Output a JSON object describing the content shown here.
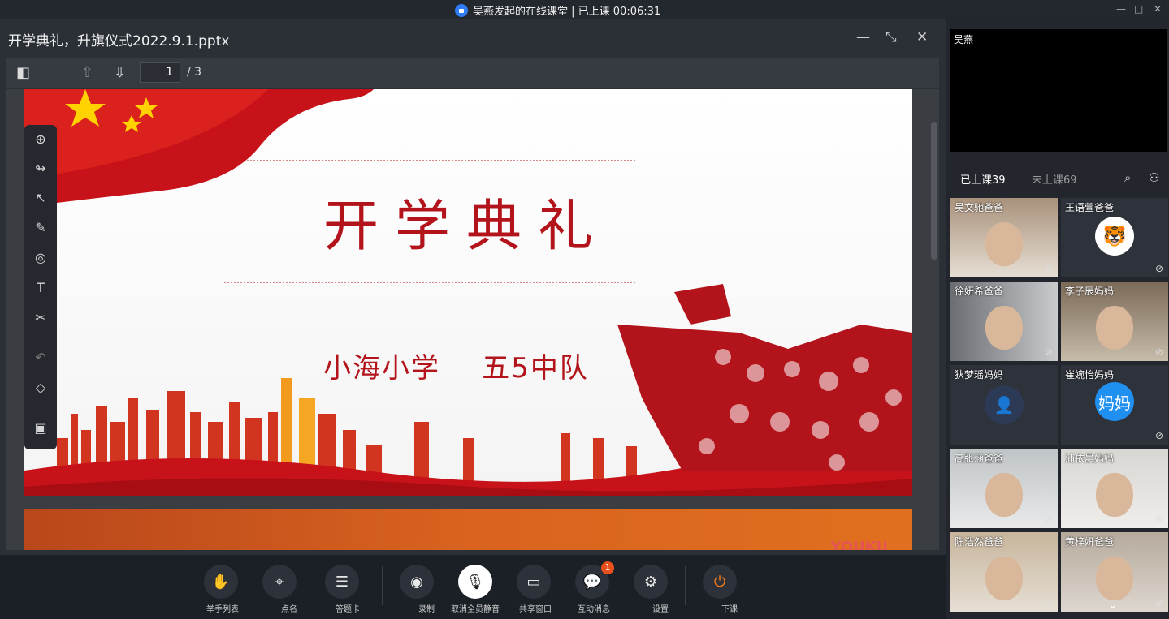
{
  "window": {
    "title": "吴燕发起的在线课堂 | 已上课 00:06:31",
    "controls": [
      "—",
      "□",
      "✕"
    ]
  },
  "document": {
    "filename": "开学典礼，升旗仪式2022.9.1.pptx",
    "current_page": "1",
    "total_pages": "/ 3"
  },
  "slide": {
    "headline": "开学典礼",
    "subline": "小海小学    五5中队"
  },
  "slide2": {
    "watermark": "YOUKU"
  },
  "side_tools": [
    {
      "name": "open-file-icon",
      "glyph": "⊕"
    },
    {
      "name": "laser-pointer-icon",
      "glyph": "↬"
    },
    {
      "name": "select-arrow-icon",
      "glyph": "↖"
    },
    {
      "name": "pen-icon",
      "glyph": "✎"
    },
    {
      "name": "shapes-icon",
      "glyph": "◎"
    },
    {
      "name": "text-icon",
      "glyph": "T"
    },
    {
      "name": "scissors-icon",
      "glyph": "✂"
    },
    {
      "name": "undo-icon",
      "glyph": "↶"
    },
    {
      "name": "eraser-icon",
      "glyph": "◇"
    },
    {
      "name": "toolbox-icon",
      "glyph": "▣"
    }
  ],
  "bottom_buttons": [
    {
      "label": "举手列表",
      "glyph": "✋"
    },
    {
      "label": "点名",
      "glyph": "⌖"
    },
    {
      "label": "答题卡",
      "glyph": "☰"
    },
    {
      "label": "录制",
      "glyph": "◉"
    },
    {
      "label": "取消全员静音",
      "glyph": "🎙"
    },
    {
      "label": "共享窗口",
      "glyph": "▭"
    },
    {
      "label": "互动消息",
      "glyph": "💬",
      "badge": "1"
    },
    {
      "label": "设置",
      "glyph": "⚙"
    },
    {
      "label": "下课",
      "glyph": "⏻"
    }
  ],
  "teacher": {
    "name": "吴燕"
  },
  "tabs": {
    "attended": "已上课39",
    "absent": "未上课69"
  },
  "participants": [
    {
      "name": "吴文驰爸爸",
      "type": "video"
    },
    {
      "name": "王语萱爸爸",
      "type": "avatar",
      "avatar_color": "#ffffff"
    },
    {
      "name": "徐妍希爸爸",
      "type": "video"
    },
    {
      "name": "李子辰妈妈",
      "type": "video"
    },
    {
      "name": "狄梦瑶妈妈",
      "type": "avatar",
      "avatar_color": "#2d3a55"
    },
    {
      "name": "崔婉怡妈妈",
      "type": "avatar",
      "avatar_color": "#1f8ff0",
      "avatar_text": "妈妈"
    },
    {
      "name": "高张涵爸爸",
      "type": "video"
    },
    {
      "name": "浦依晨妈妈",
      "type": "video"
    },
    {
      "name": "陈浩然爸爸",
      "type": "video"
    },
    {
      "name": "黄梓妍爸爸",
      "type": "video"
    }
  ],
  "colors": {
    "accent_red": "#b3141b",
    "badge_orange": "#e8501e",
    "blue_avatar": "#1f8ff0"
  }
}
